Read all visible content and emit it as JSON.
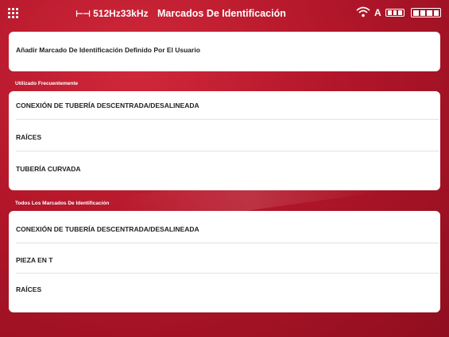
{
  "header": {
    "frequency": "512Hz33kHz",
    "title": "Marcados De Identificación",
    "icons": [
      "menu-grid-icon",
      "frequency-icon",
      "wifi-icon",
      "a-icon",
      "keyboard-icon",
      "battery-icon"
    ]
  },
  "add_marker": {
    "label": "Añadir Marcado De Identificación Definido Por El Usuario"
  },
  "frequent": {
    "heading": "Utilizado Frecuentemente",
    "items": [
      "CONEXIÓN DE TUBERÍA DESCENTRADA/DESALINEADA",
      "RAÍCES",
      "TUBERÍA CURVADA"
    ]
  },
  "all": {
    "heading": "Todos Los Marcados De Identificación",
    "items": [
      "CONEXIÓN DE TUBERÍA DESCENTRADA/DESALINEADA",
      "PIEZA EN T",
      "RAÍCES"
    ]
  },
  "colors": {
    "background": "#b3162a",
    "card": "#ffffff",
    "text": "#222222"
  }
}
